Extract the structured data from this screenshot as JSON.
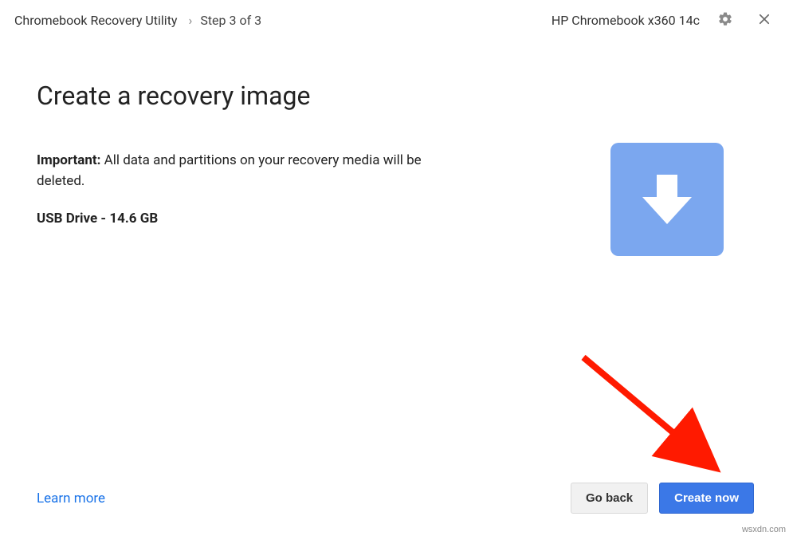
{
  "header": {
    "app_title": "Chromebook Recovery Utility",
    "separator": "›",
    "step_label": "Step 3 of 3",
    "device_name": "HP Chromebook x360 14c"
  },
  "main": {
    "title": "Create a recovery image",
    "important_label": "Important:",
    "important_text": " All data and partitions on your recovery media will be deleted.",
    "drive_info": "USB Drive - 14.6 GB"
  },
  "footer": {
    "learn_more": "Learn more",
    "go_back": "Go back",
    "create_now": "Create now"
  },
  "watermark": "wsxdn.com"
}
